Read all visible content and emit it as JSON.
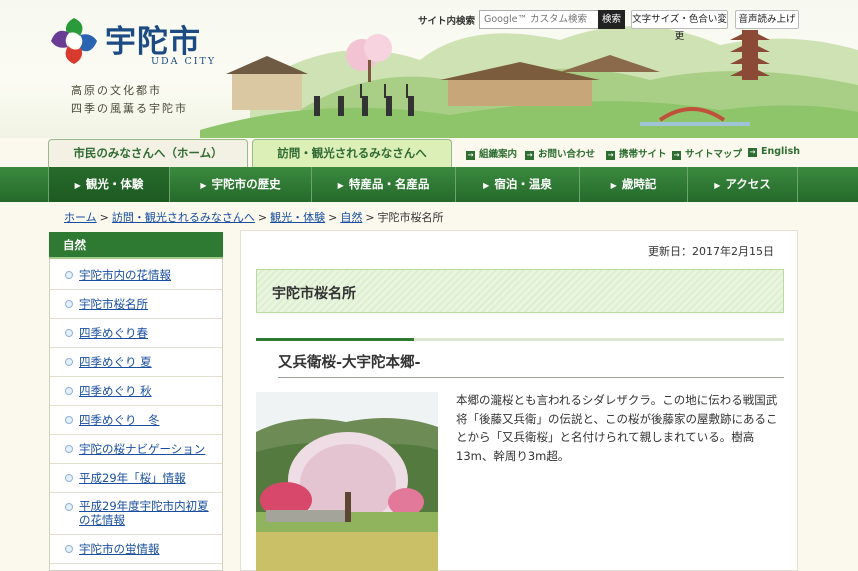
{
  "header": {
    "site_name": "宇陀市",
    "site_name_en": "UDA CITY",
    "tagline": [
      "高原の文化都市",
      "四季の風薫る宇陀市"
    ],
    "logo": "uda-city-logo"
  },
  "tools": {
    "search_label": "サイト内検索",
    "search_placeholder": "Google™ カスタム検索",
    "search_button": "検索",
    "font_color_button": "文字サイズ・色合い変更",
    "read_aloud_button": "音声読み上げ"
  },
  "audience_tabs": [
    {
      "label": "市民のみなさんへ（ホーム）",
      "active": false
    },
    {
      "label": "訪問・観光されるみなさんへ",
      "active": true
    }
  ],
  "utility_links": [
    "組織案内",
    "お問い合わせ",
    "携帯サイト",
    "サイトマップ",
    "English"
  ],
  "global_nav": [
    {
      "label": "観光・体験",
      "active": true
    },
    {
      "label": "宇陀市の歴史",
      "active": false
    },
    {
      "label": "特産品・名産品",
      "active": false
    },
    {
      "label": "宿泊・温泉",
      "active": false
    },
    {
      "label": "歳時記",
      "active": false
    },
    {
      "label": "アクセス",
      "active": false
    }
  ],
  "breadcrumb": {
    "links": [
      "ホーム",
      "訪問・観光されるみなさんへ",
      "観光・体験",
      "自然"
    ],
    "current": "宇陀市桜名所",
    "separator": ">"
  },
  "side_menu": {
    "title": "自然",
    "items": [
      "宇陀市内の花情報",
      "宇陀市桜名所",
      "四季めぐり春",
      "四季めぐり 夏",
      "四季めぐり 秋",
      "四季めぐり　冬",
      "宇陀の桜ナビゲーション",
      "平成29年「桜」情報",
      "平成29年度宇陀市内初夏の花情報",
      "宇陀市の蛍情報"
    ]
  },
  "main": {
    "updated": "更新日：2017年2月15日",
    "page_title": "宇陀市桜名所",
    "section_title": "又兵衛桜-大宇陀本郷-",
    "section_body": "本郷の瀧桜とも言われるシダレザクラ。この地に伝わる戦国武\n将「後藤又兵衛」の伝説と、この桜が後藤家の屋敷跡にあるこ\nとから「又兵衛桜」と名付けられて親しまれている。樹高\n13m、幹周り3m超。",
    "photo": "matabei-zakura-photo"
  },
  "colors": {
    "nav_green": "#2f7a33",
    "link_blue": "#1a4fa0",
    "logo_blue": "#1c4b83",
    "page_bg": "#fbf8ee"
  }
}
